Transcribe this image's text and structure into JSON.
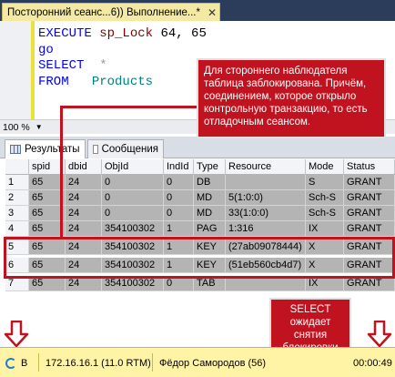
{
  "tab": {
    "title": "Посторонний сеанс...6)) Выполнение...*",
    "close": "✕"
  },
  "code": {
    "line1_kw": "EXECUTE",
    "line1_fn": "sp_Lock",
    "line1_args": "64, 65",
    "line2_kw": "go",
    "line3_kw": "SELECT",
    "line3_star": "*",
    "line4_kw": "FROM",
    "line4_obj": "Products"
  },
  "zoom": {
    "value": "100 %"
  },
  "result_tabs": {
    "results": "Результаты",
    "messages": "Сообщения"
  },
  "grid": {
    "columns": [
      "",
      "spid",
      "dbid",
      "ObjId",
      "IndId",
      "Type",
      "Resource",
      "Mode",
      "Status"
    ],
    "rows": [
      [
        "1",
        "65",
        "24",
        "0",
        "0",
        "DB",
        "",
        "S",
        "GRANT"
      ],
      [
        "2",
        "65",
        "24",
        "0",
        "0",
        "MD",
        "5(1:0:0)",
        "Sch-S",
        "GRANT"
      ],
      [
        "3",
        "65",
        "24",
        "0",
        "0",
        "MD",
        "33(1:0:0)",
        "Sch-S",
        "GRANT"
      ],
      [
        "4",
        "65",
        "24",
        "354100302",
        "1",
        "PAG",
        "1:316",
        "IX",
        "GRANT"
      ],
      [
        "5",
        "65",
        "24",
        "354100302",
        "1",
        "KEY",
        "(27ab09078444)",
        "X",
        "GRANT"
      ],
      [
        "6",
        "65",
        "24",
        "354100302",
        "1",
        "KEY",
        "(51eb560cb4d7)",
        "X",
        "GRANT"
      ],
      [
        "7",
        "65",
        "24",
        "354100302",
        "0",
        "TAB",
        "",
        "IX",
        "GRANT"
      ]
    ]
  },
  "callouts": {
    "top": "Для стороннего наблюдателя таблица заблокирована. Причём, соединением, которое открыло контрольную транзакцию, то есть отладочным сеансом.",
    "bottom": "SELECT ожидает снятия блокировки"
  },
  "status": {
    "mode": "B",
    "server": "172.16.16.1 (11.0 RTM)",
    "user": "Фёдор Самородов (56)",
    "time": "00:00:49"
  },
  "colors": {
    "callout": "#c1121f",
    "status_bg": "#fff3a6",
    "tab_active": "#f3e9a3"
  }
}
